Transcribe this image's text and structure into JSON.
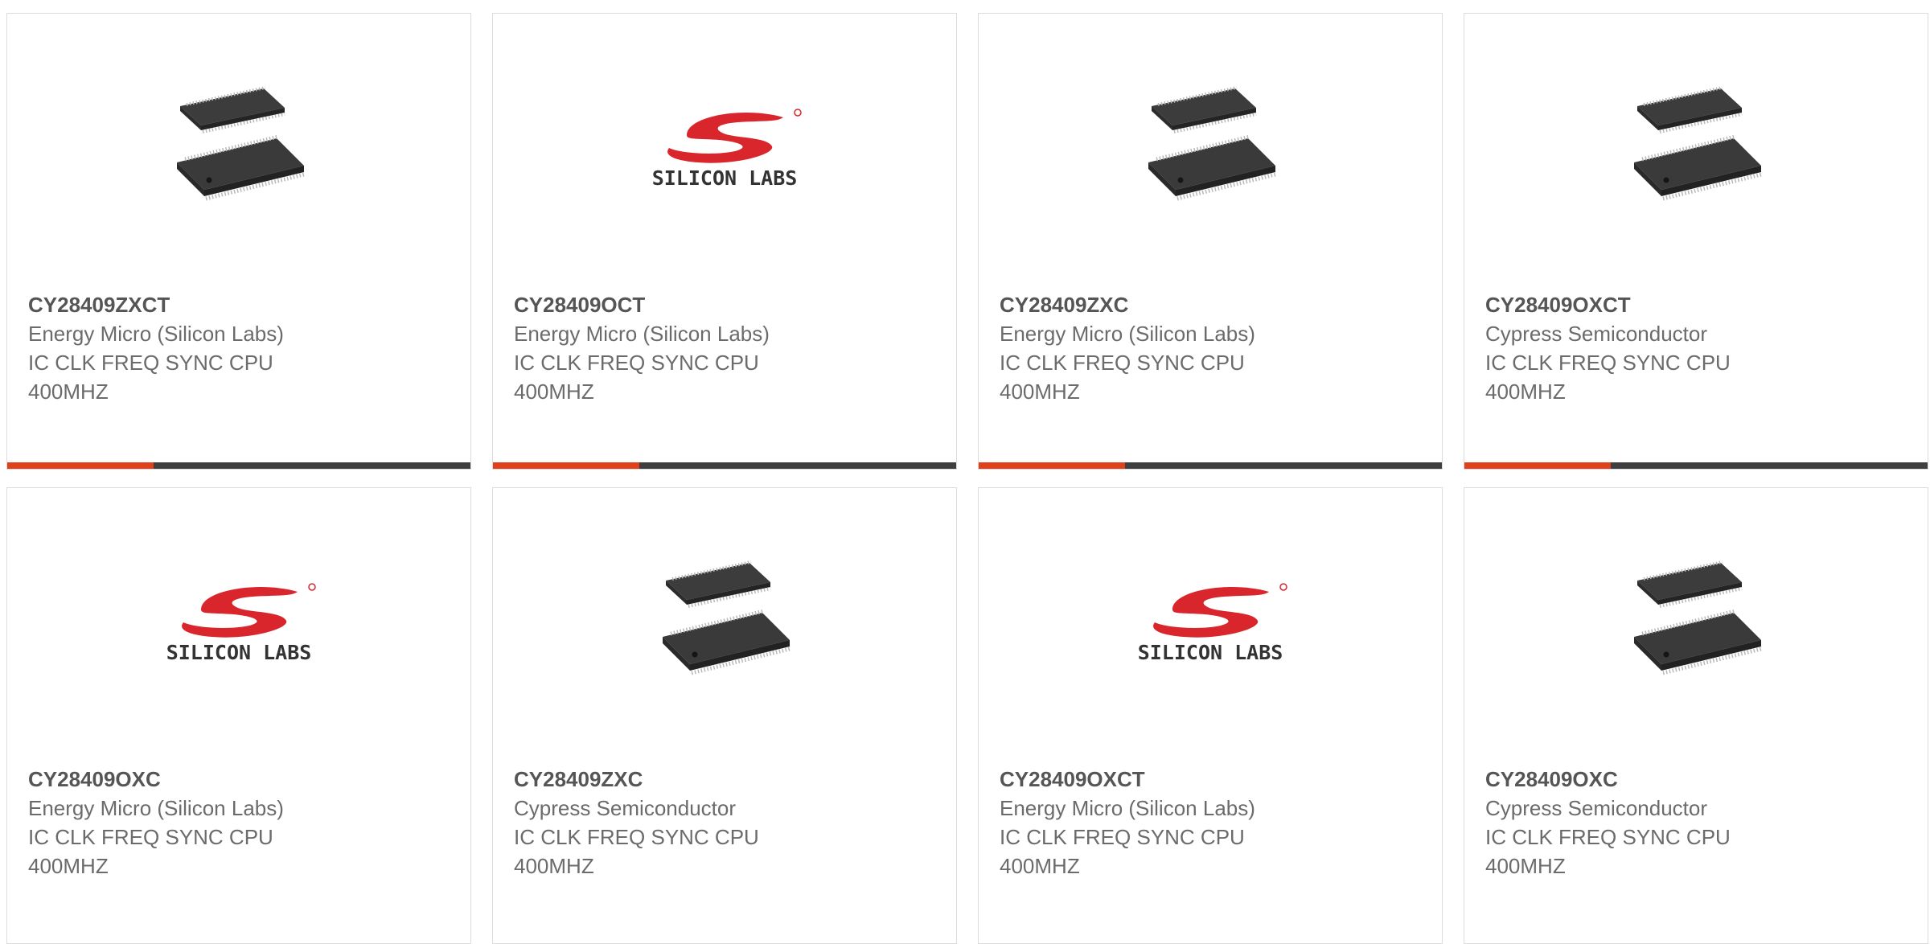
{
  "accent_color": "#e0401a",
  "bar_color": "#3f3f3f",
  "products": [
    {
      "part": "CY28409ZXCT",
      "manufacturer": "Energy Micro (Silicon Labs)",
      "desc1": "IC CLK FREQ SYNC CPU",
      "desc2": "400MHZ",
      "image": "chip-icon"
    },
    {
      "part": "CY28409OCT",
      "manufacturer": "Energy Micro (Silicon Labs)",
      "desc1": "IC CLK FREQ SYNC CPU",
      "desc2": "400MHZ",
      "image": "silicon-labs-logo",
      "logo_text": "SILICON LABS"
    },
    {
      "part": "CY28409ZXC",
      "manufacturer": "Energy Micro (Silicon Labs)",
      "desc1": "IC CLK FREQ SYNC CPU",
      "desc2": "400MHZ",
      "image": "chip-icon"
    },
    {
      "part": "CY28409OXCT",
      "manufacturer": "Cypress Semiconductor",
      "desc1": "IC CLK FREQ SYNC CPU",
      "desc2": "400MHZ",
      "image": "chip-icon"
    },
    {
      "part": "CY28409OXC",
      "manufacturer": "Energy Micro (Silicon Labs)",
      "desc1": "IC CLK FREQ SYNC CPU",
      "desc2": "400MHZ",
      "image": "silicon-labs-logo",
      "logo_text": "SILICON LABS"
    },
    {
      "part": "CY28409ZXC",
      "manufacturer": "Cypress Semiconductor",
      "desc1": "IC CLK FREQ SYNC CPU",
      "desc2": "400MHZ",
      "image": "chip-icon"
    },
    {
      "part": "CY28409OXCT",
      "manufacturer": "Energy Micro (Silicon Labs)",
      "desc1": "IC CLK FREQ SYNC CPU",
      "desc2": "400MHZ",
      "image": "silicon-labs-logo",
      "logo_text": "SILICON LABS"
    },
    {
      "part": "CY28409OXC",
      "manufacturer": "Cypress Semiconductor",
      "desc1": "IC CLK FREQ SYNC CPU",
      "desc2": "400MHZ",
      "image": "chip-icon"
    }
  ]
}
